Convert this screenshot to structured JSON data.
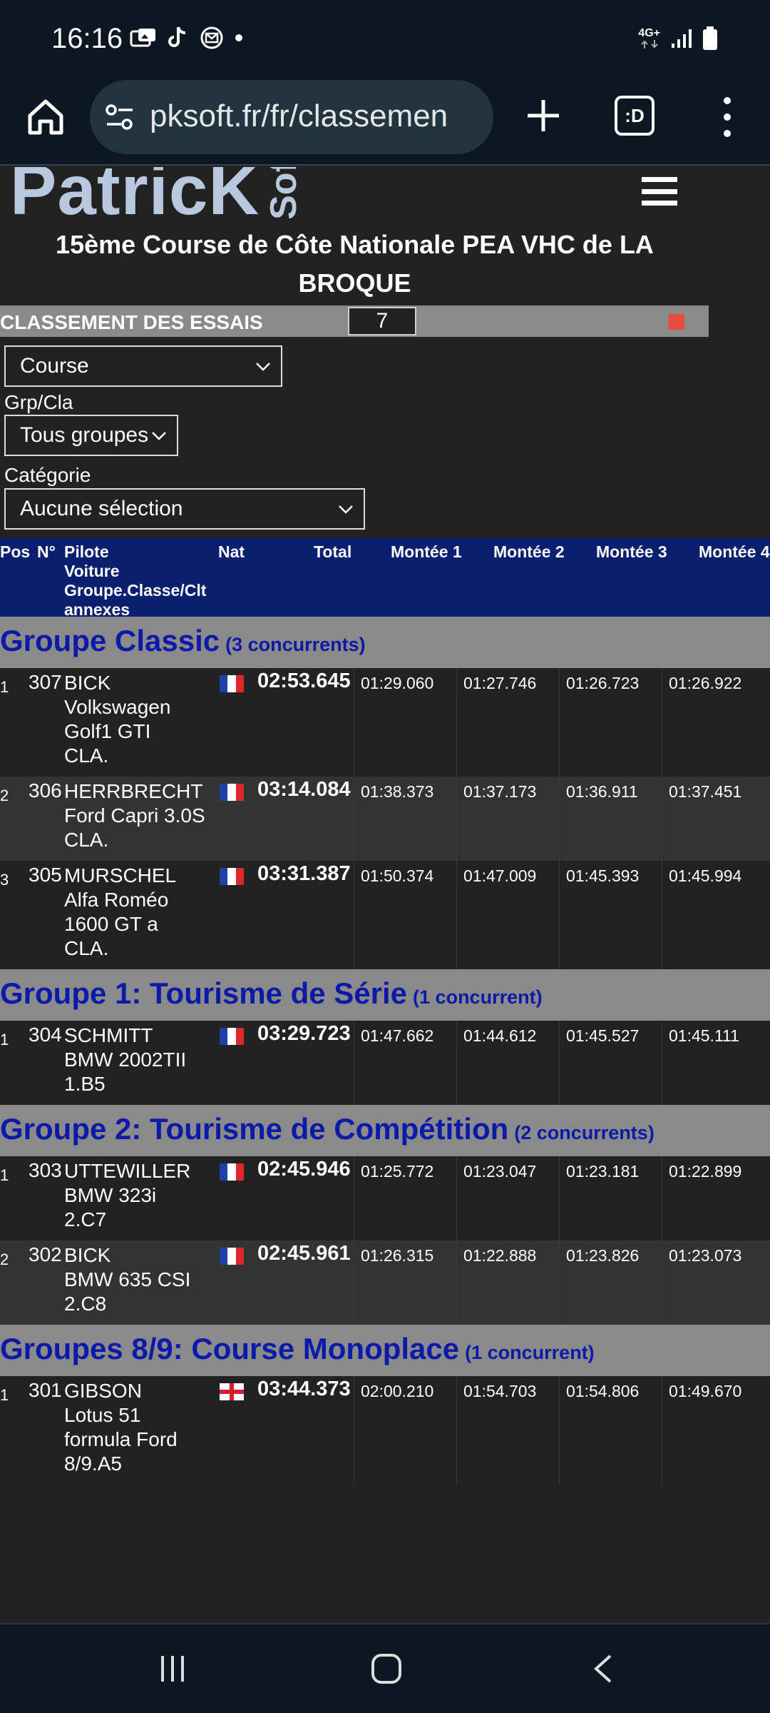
{
  "status": {
    "time": "16:16",
    "network": "4G+"
  },
  "browser": {
    "url": "pksoft.fr/fr/classemen",
    "tabs_label": ":D"
  },
  "site": {
    "logo_text": "PatricK",
    "logo_suffix": "Sof",
    "event_title": "15ème Course de Côte Nationale PEA VHC de LA BROQUE"
  },
  "classement": {
    "label": "CLASSEMENT DES ESSAIS",
    "number": "7"
  },
  "filters": {
    "course_select": "Course",
    "grp_label": "Grp/Cla",
    "grp_select": "Tous groupes",
    "cat_label": "Catégorie",
    "cat_select": "Aucune sélection"
  },
  "table_header": {
    "pos": "Pos",
    "num": "N°",
    "pilote": "Pilote",
    "voiture": "Voiture",
    "groupe": "Groupe.Classe/Clt",
    "annexes": "annexes",
    "nat": "Nat",
    "total": "Total",
    "m1": "Montée 1",
    "m2": "Montée 2",
    "m3": "Montée 3",
    "m4": "Montée 4"
  },
  "groups": [
    {
      "title": "Groupe Classic",
      "count": "(3 concurrents)",
      "rows": [
        {
          "pos": "1",
          "num": "307",
          "pilote": [
            "BICK",
            "Volkswagen",
            "Golf1 GTI",
            "CLA."
          ],
          "flag": "fr",
          "total": "02:53.645",
          "m1": "01:29.060",
          "m2": "01:27.746",
          "m3": "01:26.723",
          "m4": "01:26.922"
        },
        {
          "pos": "2",
          "num": "306",
          "pilote": [
            "HERRBRECHT",
            "Ford Capri 3.0S",
            "CLA."
          ],
          "flag": "fr",
          "total": "03:14.084",
          "m1": "01:38.373",
          "m2": "01:37.173",
          "m3": "01:36.911",
          "m4": "01:37.451"
        },
        {
          "pos": "3",
          "num": "305",
          "pilote": [
            "MURSCHEL",
            "Alfa Roméo",
            "1600 GT a",
            "CLA."
          ],
          "flag": "fr",
          "total": "03:31.387",
          "m1": "01:50.374",
          "m2": "01:47.009",
          "m3": "01:45.393",
          "m4": "01:45.994"
        }
      ]
    },
    {
      "title": "Groupe 1: Tourisme de Série",
      "count": "(1 concurrent)",
      "rows": [
        {
          "pos": "1",
          "num": "304",
          "pilote": [
            "SCHMITT",
            "BMW 2002TII",
            "1.B5"
          ],
          "flag": "fr",
          "total": "03:29.723",
          "m1": "01:47.662",
          "m2": "01:44.612",
          "m3": "01:45.527",
          "m4": "01:45.111"
        }
      ]
    },
    {
      "title": "Groupe 2: Tourisme de Compétition",
      "count": "(2 concurrents)",
      "rows": [
        {
          "pos": "1",
          "num": "303",
          "pilote": [
            "UTTEWILLER",
            "BMW 323i",
            "2.C7"
          ],
          "flag": "fr",
          "total": "02:45.946",
          "m1": "01:25.772",
          "m2": "01:23.047",
          "m3": "01:23.181",
          "m4": "01:22.899"
        },
        {
          "pos": "2",
          "num": "302",
          "pilote": [
            "BICK",
            "BMW 635 CSI",
            "2.C8"
          ],
          "flag": "fr",
          "total": "02:45.961",
          "m1": "01:26.315",
          "m2": "01:22.888",
          "m3": "01:23.826",
          "m4": "01:23.073"
        }
      ]
    },
    {
      "title": "Groupes 8/9: Course Monoplace",
      "count": "(1 concurrent)",
      "rows": [
        {
          "pos": "1",
          "num": "301",
          "pilote": [
            "GIBSON",
            "Lotus 51",
            "formula Ford",
            "8/9.A5"
          ],
          "flag": "en",
          "total": "03:44.373",
          "m1": "02:00.210",
          "m2": "01:54.703",
          "m3": "01:54.806",
          "m4": "01:49.670"
        }
      ]
    }
  ]
}
